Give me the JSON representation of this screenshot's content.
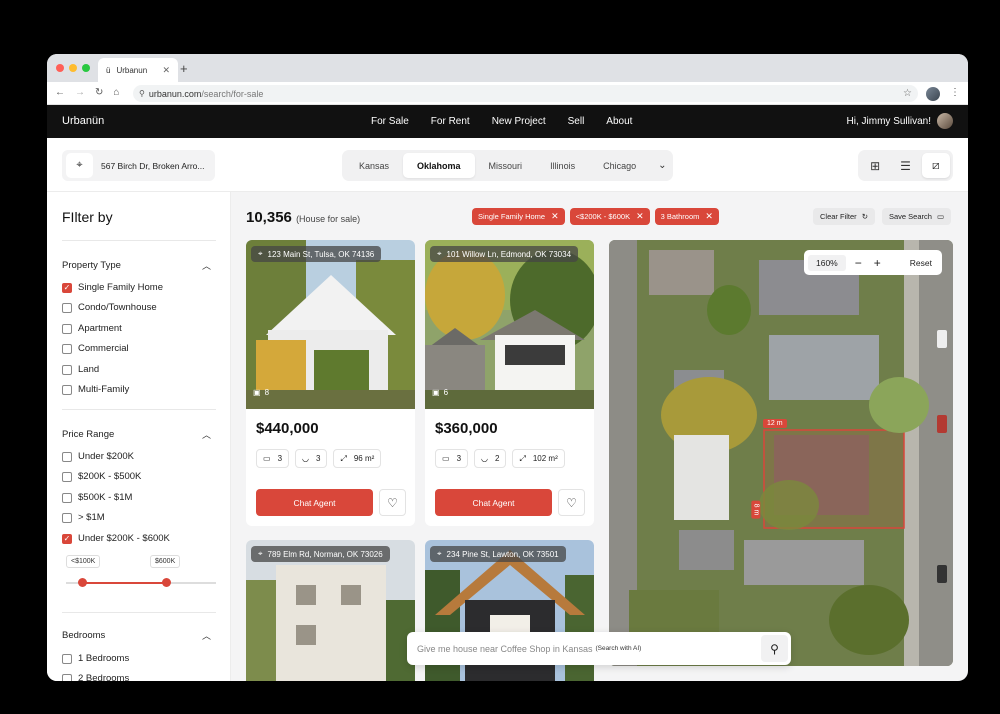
{
  "browser": {
    "tab_title": "Urbanun",
    "tab_icon": "ü",
    "url_host": "urbanun.com",
    "url_path": "/search/for-sale",
    "traffic_colors": [
      "#ff5f57",
      "#febc2e",
      "#28c840"
    ]
  },
  "header": {
    "logo": "Urbanün",
    "nav": [
      "For Sale",
      "For Rent",
      "New Project",
      "Sell",
      "About"
    ],
    "greeting": "Hi, Jimmy Sullivan!"
  },
  "toolbar": {
    "location": "567 Birch Dr, Broken Arro...",
    "states": [
      "Kansas",
      "Oklahoma",
      "Missouri",
      "Illinois",
      "Chicago"
    ],
    "active_state": "Oklahoma"
  },
  "sidebar": {
    "title": "FIlter by",
    "property_type": {
      "title": "Property Type",
      "options": [
        {
          "label": "Single Family Home",
          "checked": true
        },
        {
          "label": "Condo/Townhouse",
          "checked": false
        },
        {
          "label": "Apartment",
          "checked": false
        },
        {
          "label": "Commercial",
          "checked": false
        },
        {
          "label": "Land",
          "checked": false
        },
        {
          "label": "Multi-Family",
          "checked": false
        }
      ]
    },
    "price_range": {
      "title": "Price Range",
      "options": [
        {
          "label": "Under $200K",
          "checked": false
        },
        {
          "label": "$200K - $500K",
          "checked": false
        },
        {
          "label": "$500K - $1M",
          "checked": false
        },
        {
          "label": "> $1M",
          "checked": false
        },
        {
          "label": "Under $200K - $600K",
          "checked": true
        }
      ],
      "min_label": "<$100K",
      "max_label": "$600K"
    },
    "bedrooms": {
      "title": "Bedrooms",
      "options": [
        {
          "label": "1 Bedrooms",
          "checked": false
        },
        {
          "label": "2 Bedrooms",
          "checked": false
        }
      ]
    }
  },
  "results": {
    "count": "10,356",
    "label": "(House for sale)"
  },
  "chips": [
    "Single Family Home",
    "<$200K - $600K",
    "3 Bathroom"
  ],
  "actions": {
    "clear": "Clear Filter",
    "save": "Save Search"
  },
  "listings": [
    {
      "address": "123 Main St, Tulsa, OK 74136",
      "photos": "8",
      "price": "$440,000",
      "beds": "3",
      "baths": "3",
      "area": "96 m²",
      "cta": "Chat Agent"
    },
    {
      "address": "101 Willow Ln, Edmond, OK 73034",
      "photos": "6",
      "price": "$360,000",
      "beds": "3",
      "baths": "2",
      "area": "102 m²",
      "cta": "Chat Agent"
    },
    {
      "address": "789 Elm Rd, Norman, OK 73026"
    },
    {
      "address": "234 Pine St, Lawton, OK 73501"
    }
  ],
  "map": {
    "zoom": "160%",
    "minus": "−",
    "plus": "+",
    "reset": "Reset",
    "measure_top": "12 m",
    "measure_side": "8 m"
  },
  "ai_search": {
    "placeholder": "Give me house near Coffee Shop in Kansas",
    "hint": "(Search with AI)"
  },
  "colors": {
    "accent": "#d9473a",
    "header": "#111111"
  }
}
